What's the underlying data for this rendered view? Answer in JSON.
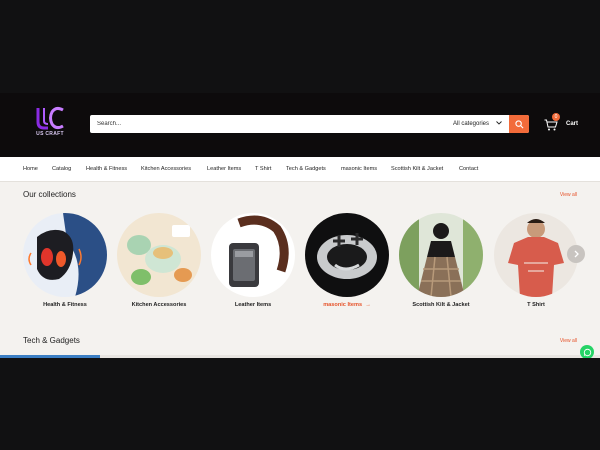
{
  "header": {
    "logo_text": "US CRAFT",
    "search_placeholder": "Search...",
    "category_label": "All categories",
    "cart_label": "Cart",
    "cart_count": "0"
  },
  "nav": {
    "items": [
      {
        "label": "Home"
      },
      {
        "label": "Catalog"
      },
      {
        "label": "Health & Fitness"
      },
      {
        "label": "Kitchen Accessories"
      },
      {
        "label": "Leather Items"
      },
      {
        "label": "T Shirt"
      },
      {
        "label": "Tech & Gadgets"
      },
      {
        "label": "masonic Items"
      },
      {
        "label": "Scottish Kilt & Jacket"
      },
      {
        "label": "Contact"
      }
    ]
  },
  "collections": {
    "title": "Our collections",
    "view_all": "View all",
    "items": [
      {
        "label": "Health & Fitness"
      },
      {
        "label": "Kitchen Accessories"
      },
      {
        "label": "Leather Items"
      },
      {
        "label": "masonic Items",
        "arrow": "→"
      },
      {
        "label": "Scottish Kilt & Jacket"
      },
      {
        "label": "T Shirt"
      }
    ]
  },
  "tech": {
    "title": "Tech & Gadgets",
    "view_all": "View all"
  },
  "colors": {
    "accent": "#f26b3a",
    "link": "#e6532a",
    "header_bg": "#0d0b0c",
    "page_bg": "#f4f2ef"
  },
  "icons": [
    "logo-icon",
    "search-icon",
    "chevron-down-icon",
    "cart-icon",
    "chevron-right-icon",
    "whatsapp-icon"
  ]
}
